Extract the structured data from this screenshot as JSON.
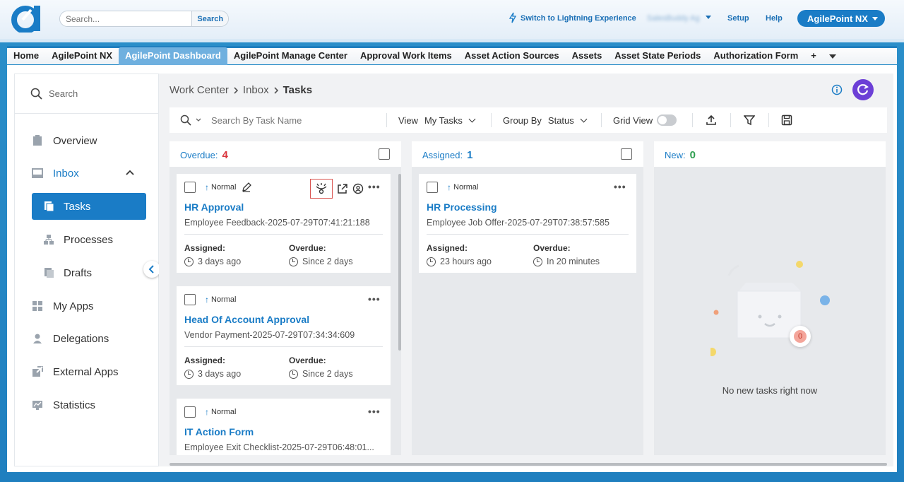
{
  "header": {
    "search_placeholder": "Search...",
    "search_button": "Search",
    "lightning_link": "Switch to Lightning Experience",
    "user_name": "SalesBuddy Ag",
    "setup": "Setup",
    "help": "Help",
    "app_switcher": "AgilePoint NX"
  },
  "tabs": [
    "Home",
    "AgilePoint NX",
    "AgilePoint Dashboard",
    "AgilePoint Manage Center",
    "Approval Work Items",
    "Asset Action Sources",
    "Assets",
    "Asset State Periods",
    "Authorization Form",
    "+"
  ],
  "active_tab": "AgilePoint Dashboard",
  "sidebar": {
    "search_label": "Search",
    "items": {
      "overview": "Overview",
      "inbox": "Inbox",
      "tasks": "Tasks",
      "processes": "Processes",
      "drafts": "Drafts",
      "my_apps": "My Apps",
      "delegations": "Delegations",
      "external_apps": "External Apps",
      "statistics": "Statistics"
    }
  },
  "breadcrumb": [
    "Work Center",
    "Inbox",
    "Tasks"
  ],
  "toolbar": {
    "search_placeholder": "Search By Task Name",
    "view_label": "View",
    "view_value": "My Tasks",
    "group_label": "Group By",
    "group_value": "Status",
    "grid_label": "Grid View"
  },
  "columns": [
    {
      "name": "Overdue:",
      "count": "4",
      "count_color": "#d9363e",
      "cards": [
        {
          "priority": "Normal",
          "title": "HR Approval",
          "subtitle": "Employee Feedback-2025-07-29T07:41:21:188",
          "assigned_label": "Assigned:",
          "assigned": "3 days ago",
          "overdue_label": "Overdue:",
          "overdue": "Since 2 days"
        },
        {
          "priority": "Normal",
          "title": "Head Of Account Approval",
          "subtitle": "Vendor Payment-2025-07-29T07:34:34:609",
          "assigned_label": "Assigned:",
          "assigned": "3 days ago",
          "overdue_label": "Overdue:",
          "overdue": "Since 2 days"
        },
        {
          "priority": "Normal",
          "title": "IT Action Form",
          "subtitle": "Employee Exit Checklist-2025-07-29T06:48:01..."
        }
      ]
    },
    {
      "name": "Assigned:",
      "count": "1",
      "count_color": "#1a7cc6",
      "cards": [
        {
          "priority": "Normal",
          "title": "HR Processing",
          "subtitle": "Employee Job Offer-2025-07-29T07:38:57:585",
          "assigned_label": "Assigned:",
          "assigned": "23 hours ago",
          "overdue_label": "Overdue:",
          "overdue": "In 20 minutes"
        }
      ]
    },
    {
      "name": "New:",
      "count": "0",
      "count_color": "#2e9e4f",
      "empty_message": "No new tasks right now",
      "empty_badge": "0"
    }
  ]
}
